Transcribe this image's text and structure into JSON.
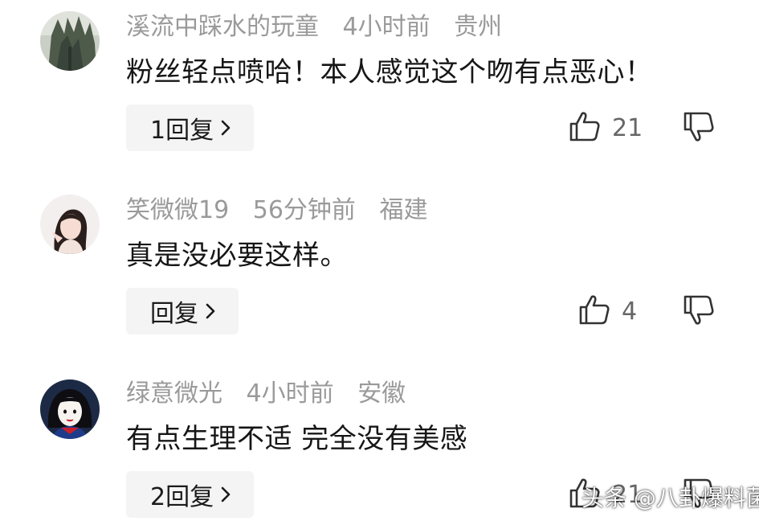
{
  "comments": [
    {
      "username": "溪流中踩水的玩童",
      "time": "4小时前",
      "location": "贵州",
      "text": "粉丝轻点喷哈！本人感觉这个吻有点恶心！",
      "reply_label": "1回复",
      "likes": "21",
      "avatar_icon": "tree-photo-avatar"
    },
    {
      "username": "笑微微19",
      "time": "56分钟前",
      "location": "福建",
      "text": "真是没必要这样。",
      "reply_label": "回复",
      "likes": "4",
      "avatar_icon": "woman-photo-avatar"
    },
    {
      "username": "绿意微光",
      "time": "4小时前",
      "location": "安徽",
      "text": "有点生理不适 完全没有美感",
      "reply_label": "2回复",
      "likes": "21",
      "avatar_icon": "cartoon-princess-avatar"
    }
  ],
  "icons": {
    "like": "thumbs-up-icon",
    "dislike": "thumbs-down-icon",
    "chevron": "chevron-right-icon"
  },
  "watermark": "头条 @八卦爆料菌",
  "colors": {
    "meta_text": "#9a9a9a",
    "content_text": "#161616",
    "reply_bg": "#f4f4f4"
  }
}
